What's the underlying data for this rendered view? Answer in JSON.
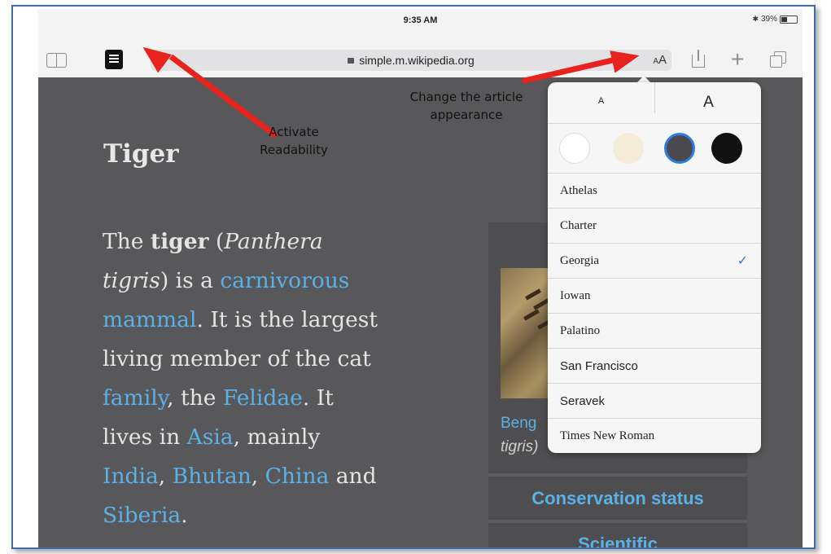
{
  "status_bar": {
    "time": "9:35 AM",
    "bluetooth": "✱",
    "battery": "39%"
  },
  "toolbar": {
    "url": "simple.m.wikipedia.org",
    "text_size_button_small": "A",
    "text_size_button_large": "A"
  },
  "article": {
    "title": "Tiger",
    "para": {
      "l1_a": "The ",
      "l1_b": "tiger",
      "l1_c": " (",
      "l1_d": "Panthera",
      "l2_a": "tigris",
      "l2_b": ") is a ",
      "l2_c": "carnivorous",
      "l3_a": "mammal",
      "l3_b": ". It is the largest",
      "l4": "living member of the cat",
      "l5_a": "family",
      "l5_b": ", the ",
      "l5_c": "Felidae",
      "l5_d": ". It",
      "l6_a": "lives in ",
      "l6_b": "Asia",
      "l6_c": ", mainly",
      "l7_a": "India",
      "l7_b": ", ",
      "l7_c": "Bhutan",
      "l7_d": ", ",
      "l7_e": "China",
      "l7_f": " and",
      "l8_a": "Siberia",
      "l8_b": "."
    }
  },
  "infobox": {
    "caption_link": "Beng",
    "caption_italic": "tigris)",
    "conservation": "Conservation status",
    "scientific": "Scientific"
  },
  "popover": {
    "size_small": "A",
    "size_large": "A",
    "swatches": [
      "#ffffff",
      "#f4ecd8",
      "#4a4a4e",
      "#111111"
    ],
    "fonts": [
      "Athelas",
      "Charter",
      "Georgia",
      "Iowan",
      "Palatino",
      "San Francisco",
      "Seravek",
      "Times New Roman"
    ],
    "selected_font": "Georgia",
    "checkmark": "✓"
  },
  "annotations": {
    "readability_l1": "Activate",
    "readability_l2": "Readability",
    "appearance_l1": "Change the article",
    "appearance_l2": "appearance"
  },
  "colors": {
    "arrow": "#e8231e",
    "link": "#5ab1e6",
    "frame_border": "#3b6ea5"
  }
}
